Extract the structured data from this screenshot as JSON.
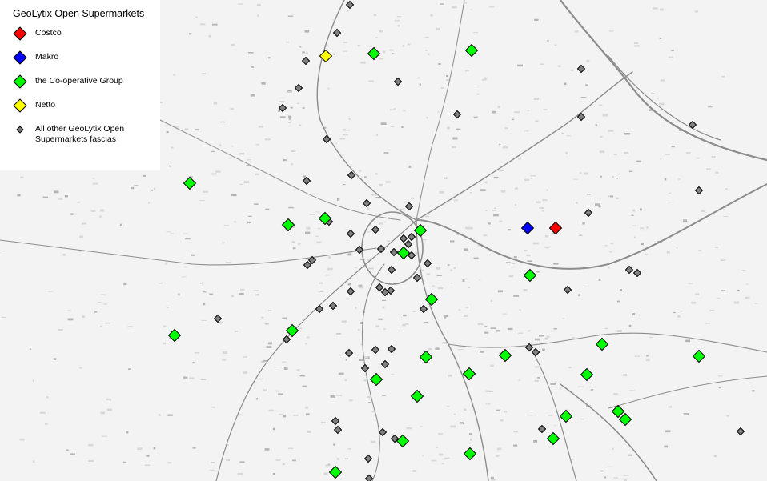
{
  "legend": {
    "title": "GeoLytix Open Supermarkets",
    "items": [
      {
        "label": "Costco",
        "symbol": "diamond",
        "color": "#ff0000"
      },
      {
        "label": "Makro",
        "symbol": "diamond",
        "color": "#0000ff"
      },
      {
        "label": "the Co-operative Group",
        "symbol": "diamond",
        "color": "#00ff00"
      },
      {
        "label": "Netto",
        "symbol": "diamond",
        "color": "#ffff00"
      },
      {
        "label": "All other GeoLytix Open Supermarkets fascias",
        "symbol": "small-diamond",
        "color": "#808080"
      }
    ]
  },
  "colors": {
    "costco": "#ff0000",
    "makro": "#0000ff",
    "coop": "#00ff00",
    "netto": "#ffff00",
    "other": "#808080",
    "outline": "#000000",
    "road": "#9a9a9a",
    "urban_fill": "#d8d8d8",
    "background": "#f3f3f3"
  }
}
